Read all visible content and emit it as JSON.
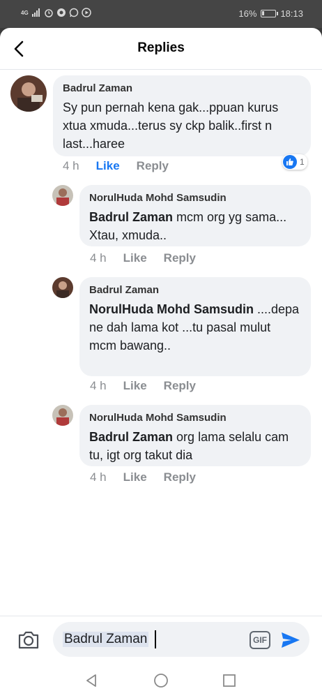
{
  "status_bar": {
    "network": "4G",
    "battery_percent": "16%",
    "battery_level": 0.16,
    "time": "18:13"
  },
  "header": {
    "title": "Replies",
    "back_icon": "chevron-left-icon"
  },
  "comments": [
    {
      "author": "Badrul Zaman",
      "mention": "",
      "text": "Sy pun pernah kena gak...ppuan kurus xtua xmuda...terus sy ckp balik..first n last...haree",
      "time": "4 h",
      "like_label": "Like",
      "reply_label": "Reply",
      "liked": true,
      "like_count": "1"
    },
    {
      "author": "NorulHuda Mohd Samsudin",
      "mention": "Badrul Zaman",
      "text": "mcm org yg sama... Xtau, xmuda..",
      "time": "4 h",
      "like_label": "Like",
      "reply_label": "Reply"
    },
    {
      "author": "Badrul Zaman",
      "mention": "NorulHuda Mohd Samsudin",
      "text": "....depa ne dah lama kot ...tu pasal mulut mcm bawang..",
      "time": "4 h",
      "like_label": "Like",
      "reply_label": "Reply"
    },
    {
      "author": "NorulHuda Mohd Samsudin",
      "mention": "Badrul Zaman",
      "text": "org lama selalu cam tu, igt org takut dia",
      "time": "4 h",
      "like_label": "Like",
      "reply_label": "Reply"
    }
  ],
  "composer": {
    "value": "Badrul Zaman",
    "gif_label": "GIF",
    "camera_icon": "camera-icon",
    "send_icon": "send-icon"
  },
  "colors": {
    "accent": "#1877f2",
    "bubble": "#f0f2f5",
    "meta_text": "#8a8d91"
  }
}
